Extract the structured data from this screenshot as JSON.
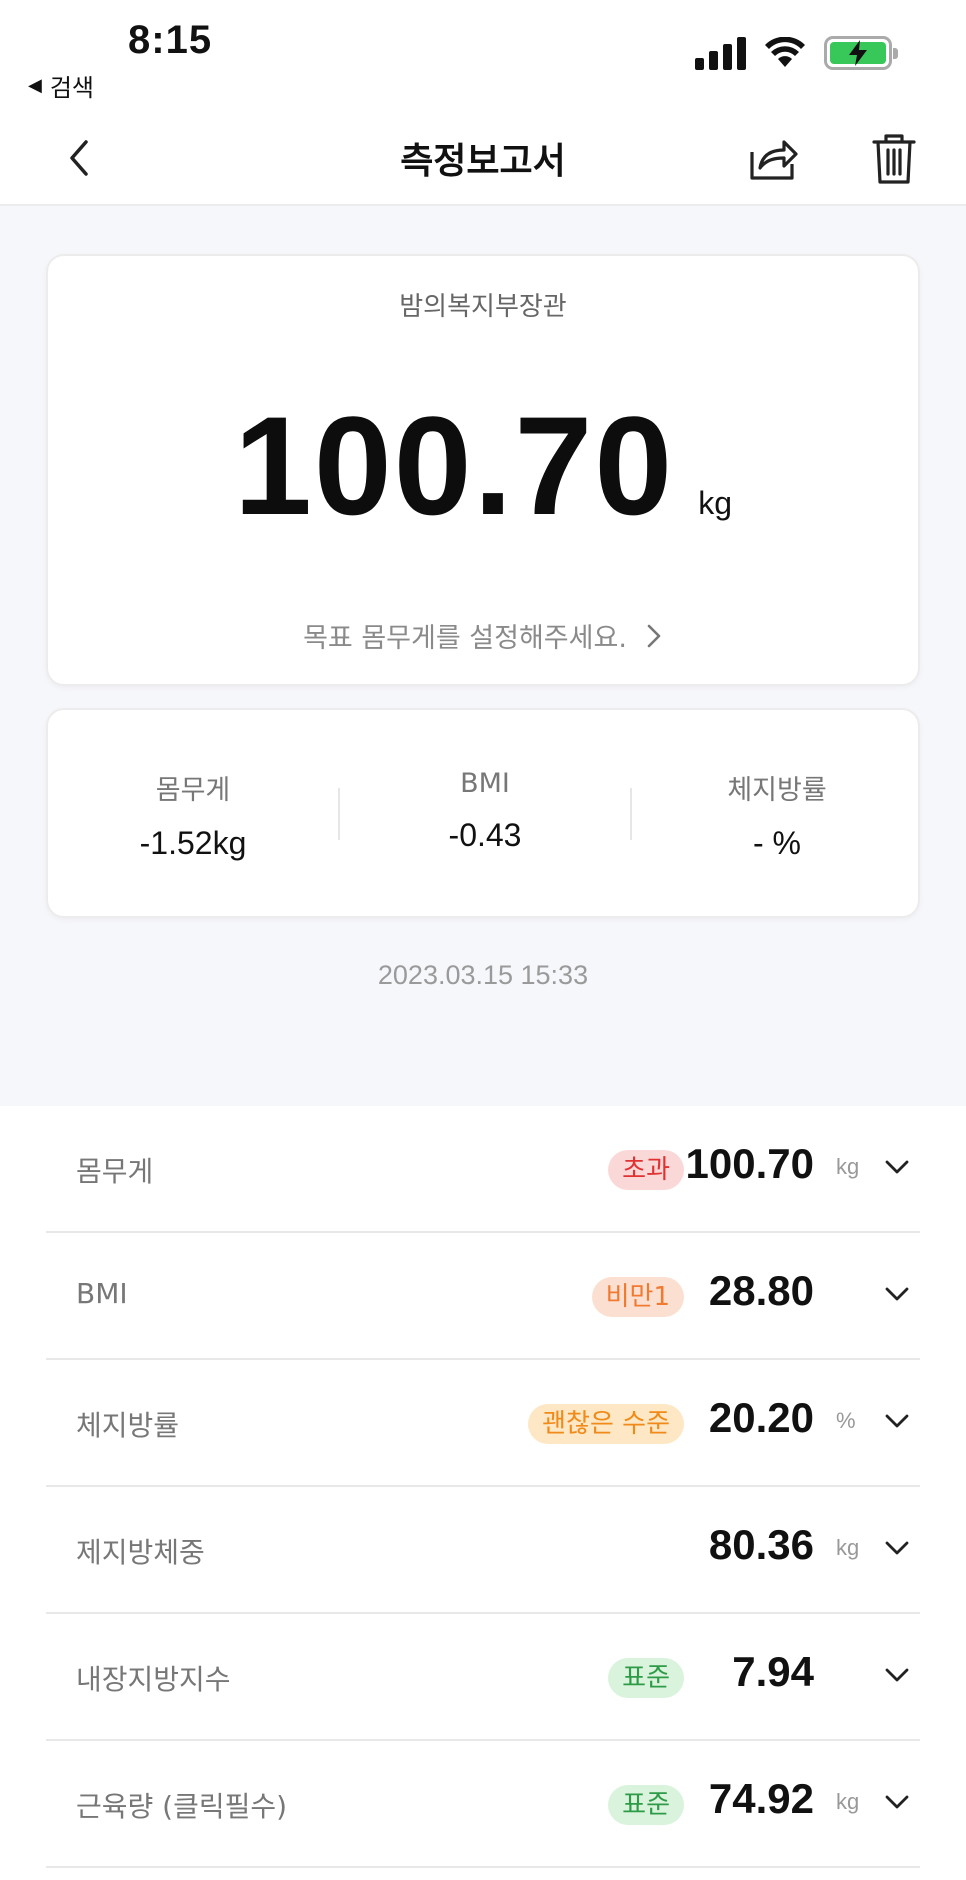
{
  "status_bar": {
    "time": "8:15",
    "back_app": "검색"
  },
  "nav": {
    "title": "측정보고서"
  },
  "main_card": {
    "device_name": "밤의복지부장관",
    "weight": "100.70",
    "unit": "kg",
    "goal_text": "목표 몸무게를 설정해주세요."
  },
  "diff_card": {
    "items": [
      {
        "label": "몸무게",
        "value": "-1.52kg"
      },
      {
        "label": "BMI",
        "value": "-0.43"
      },
      {
        "label": "체지방률",
        "value": "- %"
      }
    ]
  },
  "timestamp": "2023.03.15 15:33",
  "metrics": [
    {
      "label": "몸무게",
      "badge": "초과",
      "badge_color": "#e03232",
      "value": "100.70",
      "unit": "kg"
    },
    {
      "label": "BMI",
      "badge": "비만1",
      "badge_color": "#f07a30",
      "value": "28.80",
      "unit": ""
    },
    {
      "label": "체지방률",
      "badge": "괜찮은 수준",
      "badge_color": "#f08a18",
      "value": "20.20",
      "unit": "%"
    },
    {
      "label": "제지방체중",
      "badge": "",
      "badge_color": "",
      "value": "80.36",
      "unit": "kg"
    },
    {
      "label": "내장지방지수",
      "badge": "표준",
      "badge_color": "#2e9b48",
      "value": "7.94",
      "unit": ""
    },
    {
      "label": "근육량 (클릭필수)",
      "badge": "표준",
      "badge_color": "#2e9b48",
      "value": "74.92",
      "unit": "kg"
    }
  ]
}
